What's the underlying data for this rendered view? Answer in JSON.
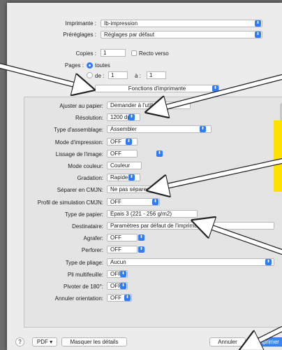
{
  "header": {
    "printer_label": "Imprimante :",
    "printer_value": "Ib-impression",
    "presets_label": "Préréglages :",
    "presets_value": "Réglages par défaut",
    "copies_label": "Copies :",
    "copies_value": "1",
    "recto_verso": "Recto verso",
    "pages_label": "Pages :",
    "pages_all": "toutes",
    "pages_from": "de :",
    "pages_from_value": "1",
    "pages_to": "à :",
    "pages_to_value": "1",
    "section_value": "Fonctions d'imprimante"
  },
  "settings": [
    {
      "label": "Ajuster au papier:",
      "value": "Demander à l'utilisateur"
    },
    {
      "label": "Résolution:",
      "value": "1200 dpi"
    },
    {
      "label": "Type d'assemblage:",
      "value": "Assembler"
    },
    {
      "label": "Mode d'impression:",
      "value": "OFF"
    },
    {
      "label": "Lissage de l'image:",
      "value": "OFF"
    },
    {
      "label": "Mode couleur:",
      "value": "Couleur"
    },
    {
      "label": "Gradation:",
      "value": "Rapide"
    },
    {
      "label": "Séparer en CMJN:",
      "value": "Ne pas séparer"
    },
    {
      "label": "Profil de simulation CMJN:",
      "value": "OFF"
    },
    {
      "label": "Type de papier:",
      "value": "Épais 3 (221 - 256 g/m2)"
    },
    {
      "label": "Destinataire:",
      "value": "Paramètres par défaut de l'imprimante"
    },
    {
      "label": "Agrafer:",
      "value": "OFF"
    },
    {
      "label": "Perforer:",
      "value": "OFF"
    },
    {
      "label": "Type de pliage:",
      "value": "Aucun"
    },
    {
      "label": "Pli multifeuille:",
      "value": "OFF"
    },
    {
      "label": "Pivoter de 180°:",
      "value": "OFF"
    },
    {
      "label": "Annuler orientation:",
      "value": "OFF"
    }
  ],
  "footer": {
    "help": "?",
    "pdf": "PDF",
    "details": "Masquer les détails",
    "cancel": "Annuler",
    "print": "Imprimer"
  },
  "colors": {
    "accent": "#2f7cf6",
    "highlight": "#ffe100"
  }
}
